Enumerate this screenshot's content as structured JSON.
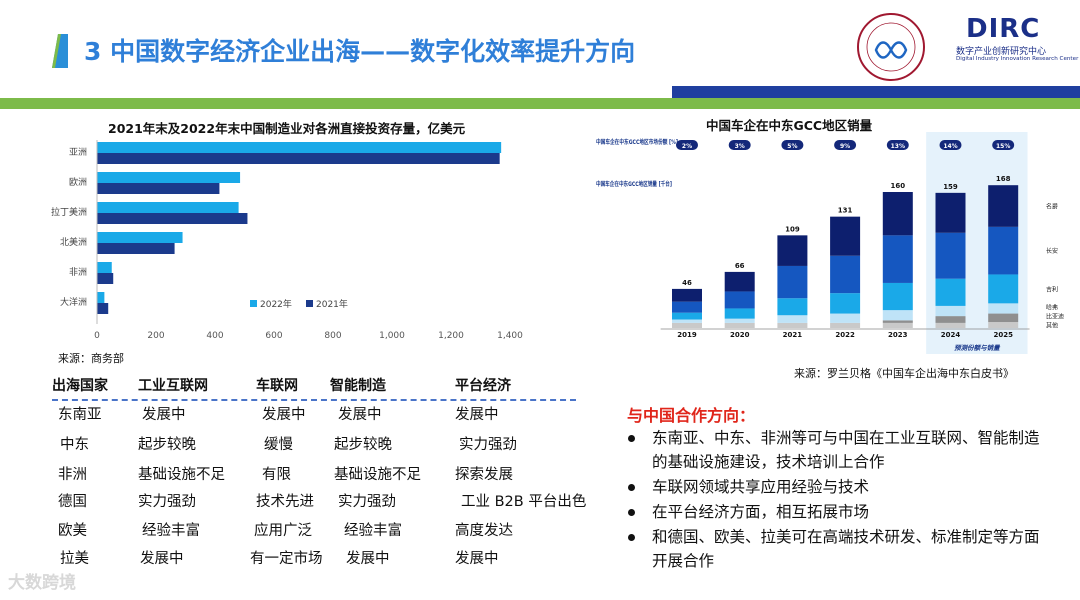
{
  "header": {
    "title": "3 中国数字经济企业出海——数字化效率提升方向",
    "logo_text": "DIRC",
    "logo_sub_cn": "数字产业创新研究中心",
    "logo_sub_en": "Digital Industry Innovation Research Center",
    "accent_green": "#7dbb4a",
    "accent_blue": "#1f3f9f",
    "title_color": "#2f7fd8"
  },
  "chart_data": [
    {
      "type": "bar",
      "orientation": "horizontal",
      "title": "2021年末及2022年末中国制造业对各洲直接投资存量，亿美元",
      "categories": [
        "亚洲",
        "欧洲",
        "拉丁美洲",
        "北美洲",
        "非洲",
        "大洋洲"
      ],
      "series": [
        {
          "name": "2022年",
          "color": "#1aa9e8",
          "values": [
            1370,
            485,
            480,
            290,
            50,
            25
          ]
        },
        {
          "name": "2021年",
          "color": "#1b3a8c",
          "values": [
            1365,
            415,
            510,
            263,
            55,
            38
          ]
        }
      ],
      "xlim": [
        0,
        1400
      ],
      "xticks": [
        "0",
        "200",
        "400",
        "600",
        "800",
        "1,000",
        "1,200",
        "1,400"
      ],
      "legend_position": "bottom-right",
      "grid": false,
      "source": "来源：商务部"
    },
    {
      "type": "bar",
      "stacked": true,
      "title": "中国车企在中东GCC地区销量",
      "categories": [
        "2019",
        "2020",
        "2021",
        "2022",
        "2023",
        "2024",
        "2025"
      ],
      "totals": [
        46,
        66,
        109,
        131,
        160,
        159,
        168
      ],
      "share_row_label": "中国车企在中东GCC地区市场份额 [%]",
      "share_values": [
        "2%",
        "3%",
        "5%",
        "9%",
        "13%",
        "14%",
        "15%"
      ],
      "sales_row_label": "中国车企在中东GCC地区销量 [千台]",
      "forecast_label": "预测份额与销量",
      "forecast_categories": [
        "2024",
        "2025"
      ],
      "series": [
        {
          "name": "其他",
          "color": "#c9c9c9",
          "values": [
            6,
            6,
            6,
            6,
            6,
            6,
            7
          ]
        },
        {
          "name": "比亚迪",
          "color": "#8f8f8f",
          "values": [
            0,
            0,
            0,
            0,
            3,
            8,
            10
          ]
        },
        {
          "name": "哈弗",
          "color": "#bfe3f7",
          "values": [
            4,
            5,
            9,
            11,
            12,
            12,
            12
          ]
        },
        {
          "name": "吉利",
          "color": "#1aa9e8",
          "values": [
            8,
            12,
            20,
            24,
            32,
            32,
            34
          ]
        },
        {
          "name": "长安",
          "color": "#1557c0",
          "values": [
            13,
            20,
            38,
            44,
            56,
            54,
            56
          ]
        },
        {
          "name": "名爵",
          "color": "#0d1f6e",
          "values": [
            15,
            23,
            36,
            46,
            51,
            47,
            49
          ]
        }
      ],
      "source": "来源：罗兰贝格《中国车企出海中东白皮书》"
    }
  ],
  "table": {
    "headers": [
      "出海国家",
      "工业互联网",
      "车联网",
      "智能制造",
      "平台经济"
    ],
    "rows": [
      [
        "东南亚",
        "发展中",
        "发展中",
        "发展中",
        "发展中"
      ],
      [
        "中东",
        "起步较晚",
        "缓慢",
        "起步较晚",
        "实力强劲"
      ],
      [
        "非洲",
        "基础设施不足",
        "有限",
        "基础设施不足",
        "探索发展"
      ],
      [
        "德国",
        "实力强劲",
        "技术先进",
        "实力强劲",
        "工业 B2B 平台出色"
      ],
      [
        "欧美",
        "经验丰富",
        "应用广泛",
        "经验丰富",
        "高度发达"
      ],
      [
        "拉美",
        "发展中",
        "有一定市场",
        "发展中",
        "发展中"
      ]
    ]
  },
  "cooperation": {
    "title": "与中国合作方向：",
    "items": [
      "东南亚、中东、非洲等可与中国在工业互联网、智能制造的基础设施建设，技术培训上合作",
      "车联网领域共享应用经验与技术",
      "在平台经济方面，相互拓展市场",
      "和德国、欧美、拉美可在高端技术研发、标准制定等方面开展合作"
    ],
    "title_color": "#e0261b"
  },
  "watermark": "大数跨境"
}
